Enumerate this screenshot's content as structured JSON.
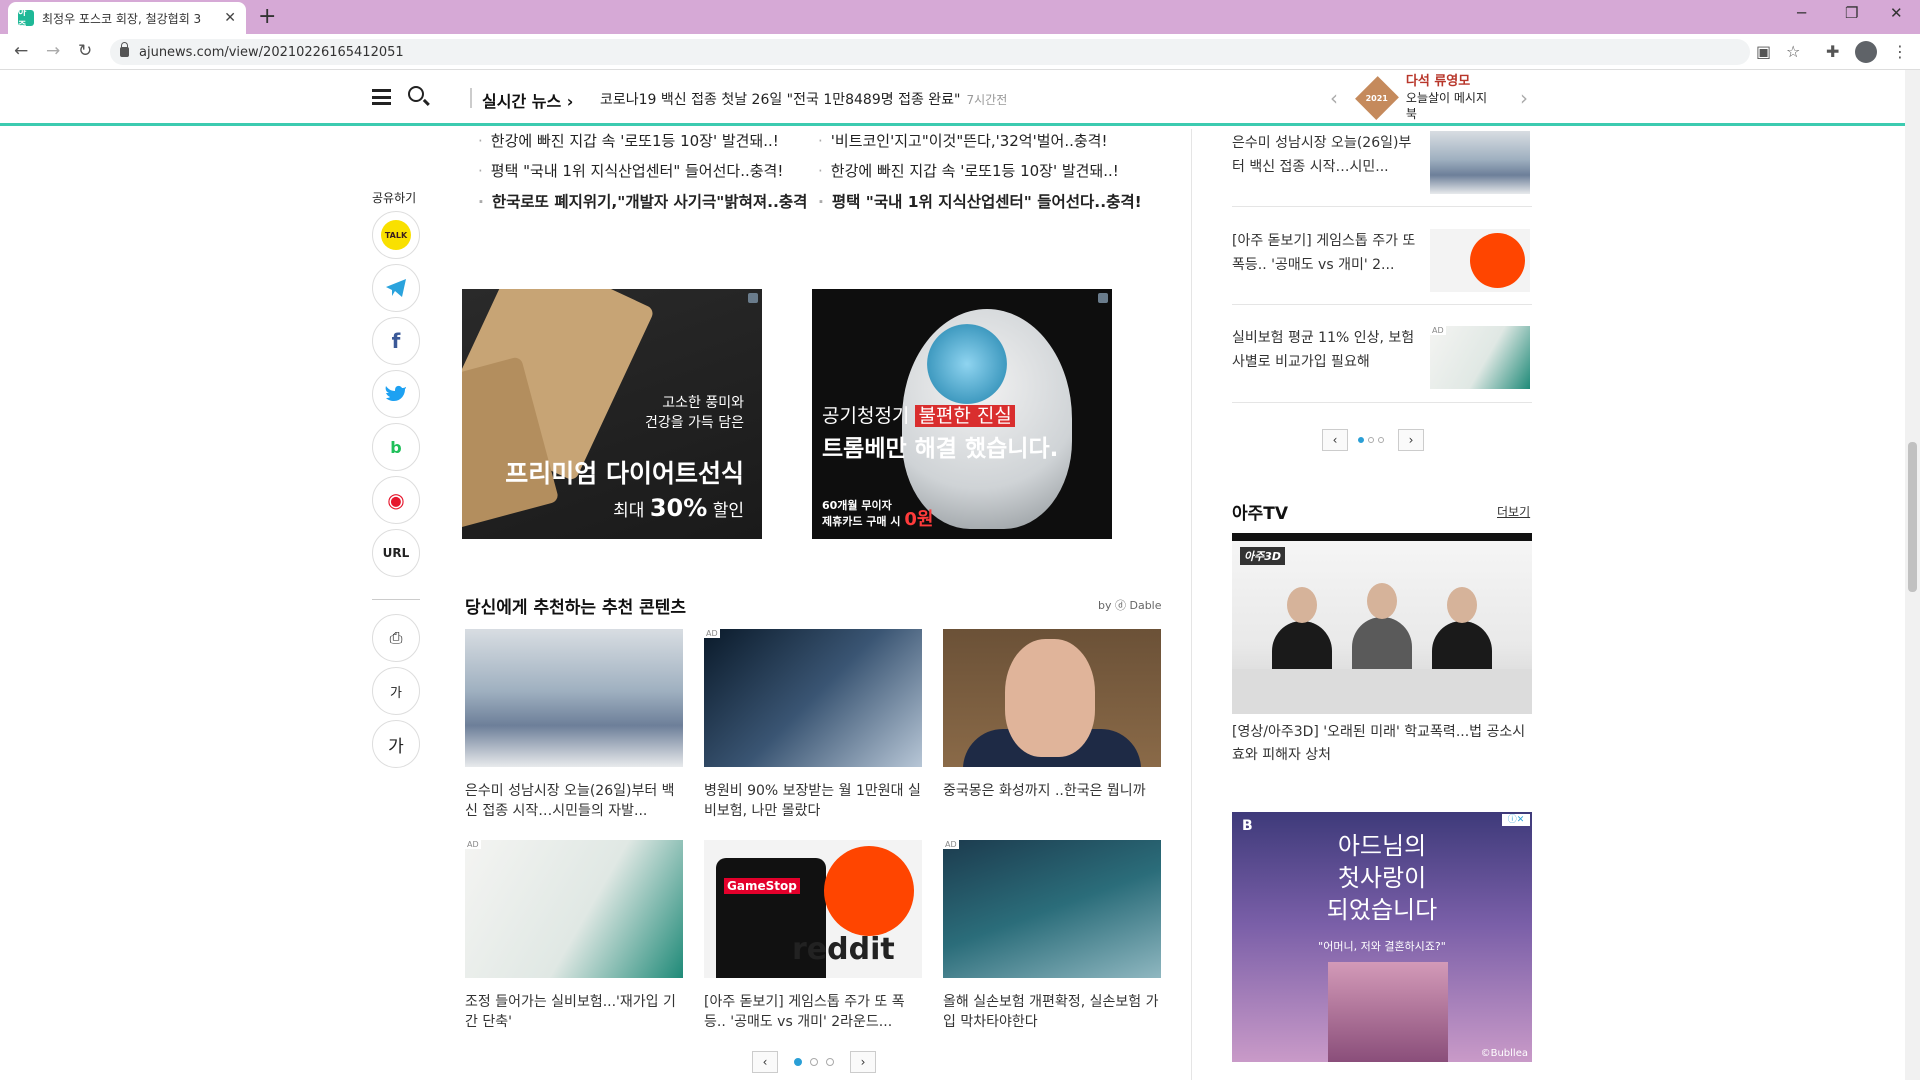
{
  "browser": {
    "tab_title": "최정우 포스코 회장, 철강협회 3",
    "tab_favicon": "아주",
    "new_tab": "+",
    "url": "ajunews.com/view/20210226165412051",
    "controls": {
      "minimize": "─",
      "maximize": "❐",
      "close": "✕"
    }
  },
  "header": {
    "live_label": "실시간 뉴스 ›",
    "live_headline": "코로나19 백신 접종 첫날 26일 \"전국 1만8489명 접종 완료\"",
    "live_time": "7시간전",
    "prev": "‹",
    "next": "›",
    "promo_name": "다석 류영모",
    "promo_sub": "오늘살이 메시지북",
    "promo_badge": "2021"
  },
  "related": [
    {
      "text": "한강에 빠진 지갑 속 '로또1등 10장' 발견돼..!",
      "bold": false
    },
    {
      "text": "'비트코인'지고\"이것\"뜬다,'32억'벌어..충격!",
      "bold": false
    },
    {
      "text": "평택 \"국내 1위 지식산업센터\" 들어선다..충격!",
      "bold": false
    },
    {
      "text": "한강에 빠진 지갑 속 '로또1등 10장' 발견돼..!",
      "bold": false
    },
    {
      "text": "한국로또 폐지위기,\"개발자 사기극\"밝혀져..충격",
      "bold": true
    },
    {
      "text": "평택 \"국내 1위 지식산업센터\" 들어선다..충격!",
      "bold": true
    }
  ],
  "bullet": "·",
  "share": {
    "label": "공유하기",
    "kakao": "TALK",
    "url_label": "URL",
    "font_small": "가",
    "font_large": "가"
  },
  "ads": {
    "ad1_line1": "고소한 풍미와",
    "ad1_line2": "건강을 가득 담은",
    "ad1_title": "프리미엄 다이어트선식",
    "ad1_discount_prefix": "최대 ",
    "ad1_discount": "30%",
    "ad1_discount_suffix": " 할인",
    "ad2_line1_a": "공기청정기 ",
    "ad2_line1_b": "불편한 진실",
    "ad2_line2": "트롬베만 해결 했습니다.",
    "ad2_small1": "60개월 무이자",
    "ad2_small2": "제휴카드 구매 시 ",
    "ad2_zero": "0원"
  },
  "recommended": {
    "title": "당신에게 추천하는 추천 콘텐츠",
    "by": "by ⓓ Dable",
    "ad_tag": "AD",
    "cards": [
      {
        "caption": "은수미 성남시장 오늘(26일)부터 백신 접종 시작…시민들의 자발...",
        "ad": false
      },
      {
        "caption": "병원비 90% 보장받는 월 1만원대 실비보험, 나만 몰랐다",
        "ad": true
      },
      {
        "caption": "중국몽은 화성까지 ..한국은 뭡니까",
        "ad": false
      },
      {
        "caption": "조정 들어가는 실비보험...'재가입 기간 단축'",
        "ad": true
      },
      {
        "caption": "[아주 돋보기] 게임스톱 주가 또 폭등.. '공매도 vs 개미' 2라운드...",
        "ad": false
      },
      {
        "caption": "올해 실손보험 개편확정, 실손보험 가입 막차타야한다",
        "ad": true
      }
    ],
    "gamestop": "GameStop",
    "reddit": "reddit"
  },
  "pager": {
    "prev": "‹",
    "next": "›"
  },
  "sidebar": {
    "items": [
      {
        "text": "은수미 성남시장 오늘(26일)부터 백신 접종 시작…시민..."
      },
      {
        "text": "[아주 돋보기] 게임스톱 주가 또 폭등.. '공매도 vs 개미' 2..."
      },
      {
        "text": "실비보험 평균 11% 인상, 보험사별로 비교가입 필요해"
      }
    ],
    "tv_title": "아주TV",
    "tv_more": "더보기",
    "tv_logo": "아주3D",
    "tv_caption": "[영상/아주3D] '오래된 미래' 학교폭력...법 공소시효와 피해자 상처",
    "ad_brand": "B",
    "ad_headline1": "아드님의",
    "ad_headline2": "첫사랑이",
    "ad_headline3": "되었습니다",
    "ad_sub": "\"어머니, 저와 결혼하시죠?\"",
    "ad_credit": "©Bubllea",
    "ad_choice": "ⓘ✕"
  },
  "colors": {
    "accent": "#3ccbb0",
    "tab_bar": "#d6a9d6",
    "pager_dot": "#2a9fd6"
  }
}
